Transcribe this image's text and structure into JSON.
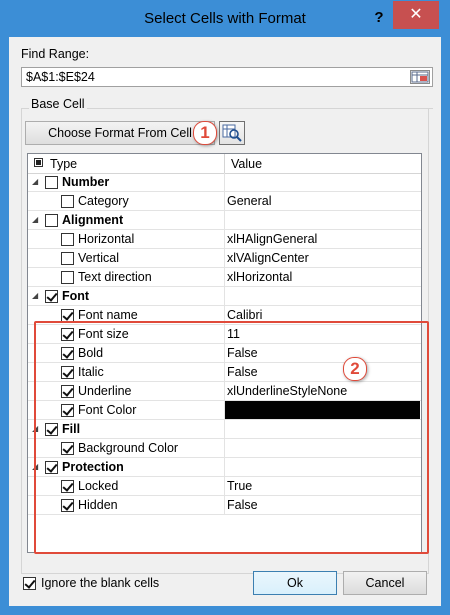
{
  "window": {
    "title": "Select Cells with Format",
    "help_label": "?",
    "close_label": "✕"
  },
  "find_range": {
    "label": "Find Range:",
    "value": "$A$1:$E$24",
    "picker_icon": "range-select-icon"
  },
  "base_cell": {
    "label": "Base Cell",
    "choose_button": "Choose Format From Cell",
    "pick_icon": "magnifier-icon",
    "badge1": "1"
  },
  "tree": {
    "headers": {
      "type": "Type",
      "value": "Value"
    },
    "rows": [
      {
        "label": "Number",
        "value": "",
        "level": 0,
        "checked": false,
        "expanded": true
      },
      {
        "label": "Category",
        "value": "General",
        "level": 1,
        "checked": false
      },
      {
        "label": "Alignment",
        "value": "",
        "level": 0,
        "checked": false,
        "expanded": true
      },
      {
        "label": "Horizontal",
        "value": "xlHAlignGeneral",
        "level": 1,
        "checked": false
      },
      {
        "label": "Vertical",
        "value": "xlVAlignCenter",
        "level": 1,
        "checked": false
      },
      {
        "label": "Text direction",
        "value": "xlHorizontal",
        "level": 1,
        "checked": false
      },
      {
        "label": "Font",
        "value": "",
        "level": 0,
        "checked": true,
        "expanded": true
      },
      {
        "label": "Font name",
        "value": "Calibri",
        "level": 1,
        "checked": true
      },
      {
        "label": "Font size",
        "value": "11",
        "level": 1,
        "checked": true
      },
      {
        "label": "Bold",
        "value": "False",
        "level": 1,
        "checked": true
      },
      {
        "label": "Italic",
        "value": "False",
        "level": 1,
        "checked": true
      },
      {
        "label": "Underline",
        "value": "xlUnderlineStyleNone",
        "level": 1,
        "checked": true
      },
      {
        "label": "Font Color",
        "value": "",
        "level": 1,
        "checked": true,
        "color": "#000000"
      },
      {
        "label": "Fill",
        "value": "",
        "level": 0,
        "checked": true,
        "expanded": true
      },
      {
        "label": "Background Color",
        "value": "",
        "level": 1,
        "checked": true
      },
      {
        "label": "Protection",
        "value": "",
        "level": 0,
        "checked": true,
        "expanded": true
      },
      {
        "label": "Locked",
        "value": "True",
        "level": 1,
        "checked": true
      },
      {
        "label": "Hidden",
        "value": "False",
        "level": 1,
        "checked": true
      }
    ],
    "badge2": "2"
  },
  "footer": {
    "ignore_blank": {
      "label": "Ignore the blank cells",
      "checked": true
    },
    "ok": "Ok",
    "cancel": "Cancel"
  },
  "colors": {
    "accent": "#3c8ed6",
    "close": "#c75050",
    "highlight": "#e04a3a"
  }
}
